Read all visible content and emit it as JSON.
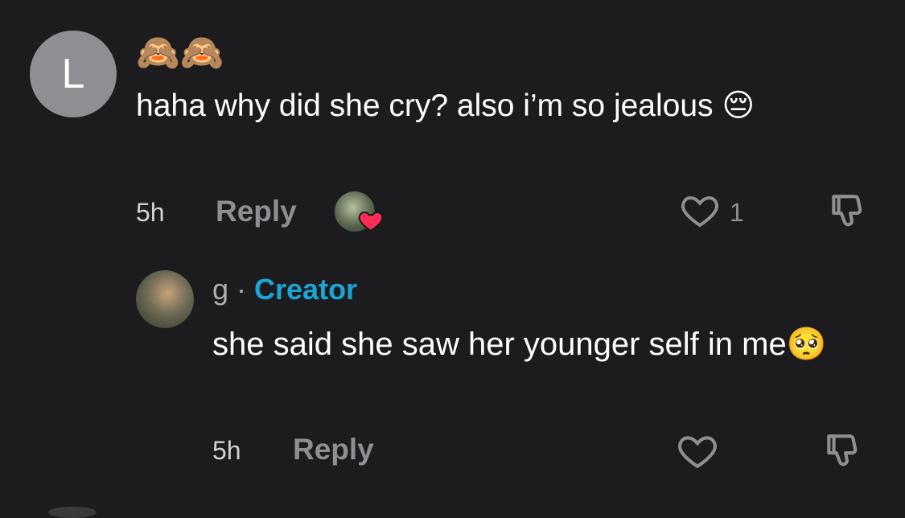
{
  "comment": {
    "avatar_letter": "L",
    "username": "🙈🙈",
    "text": "haha why did she cry? also i’m so jealous 😔",
    "time": "5h",
    "reply_label": "Reply",
    "like_count": "1"
  },
  "reply": {
    "username": "g",
    "separator": " · ",
    "badge": "Creator",
    "text": "she said she saw her younger self in me🥺",
    "time": "5h",
    "reply_label": "Reply"
  },
  "colors": {
    "background": "#1c1c1e",
    "creator_badge": "#1ba4d6",
    "heart_badge": "#ff2d55"
  },
  "icons": {
    "like": "heart-outline-icon",
    "dislike": "thumbs-down-icon",
    "liked_by_creator": "heart-filled-icon"
  }
}
